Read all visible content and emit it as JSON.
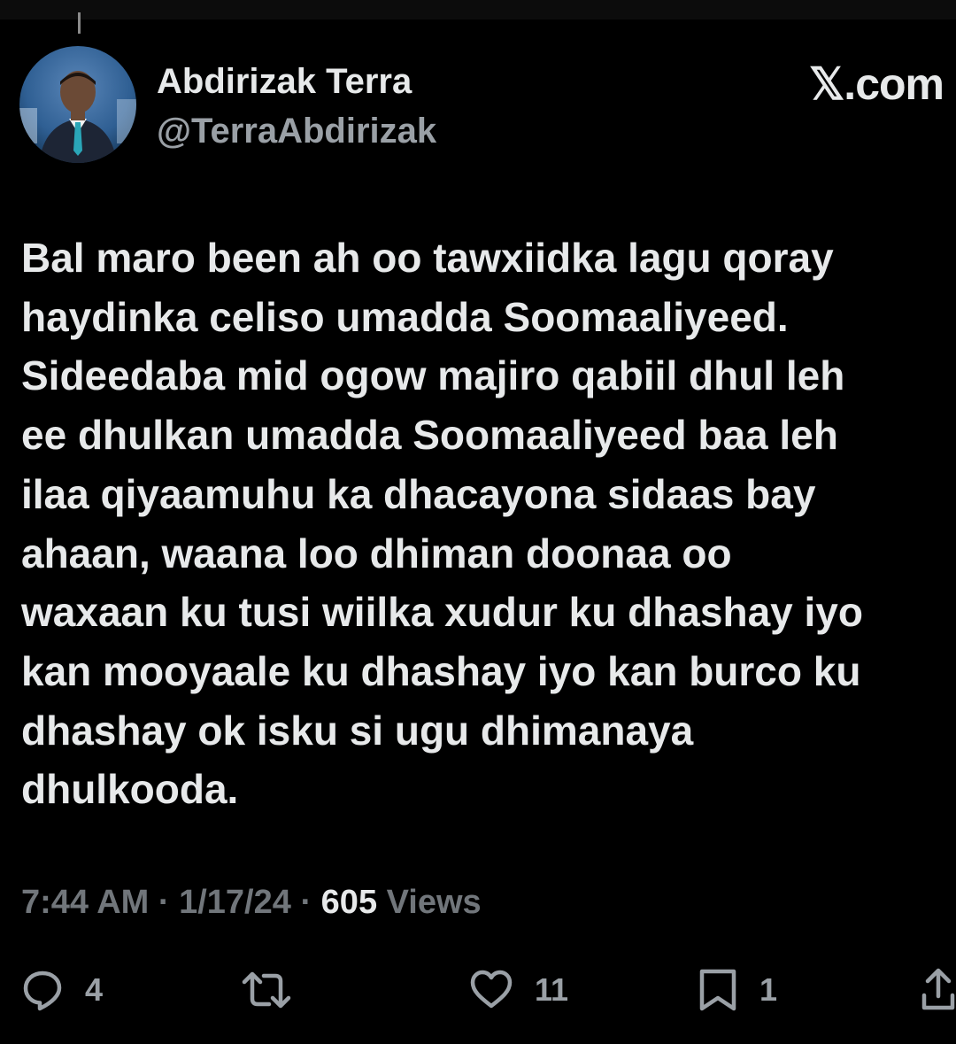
{
  "tweet": {
    "author": {
      "display_name": "Abdirizak Terra",
      "handle": "@TerraAbdirizak",
      "avatar_icon": "profile-photo"
    },
    "brand": "𝕏.com",
    "text": "Bal maro been ah oo tawxiidka lagu qoray\nhaydinka celiso umadda Soomaaliyeed.\nSideedaba mid ogow majiro qabiil dhul leh\nee dhulkan umadda Soomaaliyeed baa leh\nilaa qiyaamuhu ka dhacayona sidaas bay\nahaan, waana loo dhiman doonaa oo\nwaxaan ku tusi wiilka xudur ku dhashay iyo\nkan mooyaale ku dhashay iyo kan burco ku\ndhashay ok isku si ugu dhimanaya\ndhulkooda.",
    "meta": {
      "time": "7:44 AM",
      "separator": " · ",
      "date": "1/17/24",
      "views_count": "605",
      "views_label": "Views"
    },
    "actions": {
      "reply": {
        "icon": "reply-icon",
        "count": "4"
      },
      "repost": {
        "icon": "repost-icon",
        "count": ""
      },
      "like": {
        "icon": "heart-icon",
        "count": "11"
      },
      "bookmark": {
        "icon": "bookmark-icon",
        "count": "1"
      },
      "share": {
        "icon": "share-icon",
        "count": ""
      }
    }
  },
  "colors": {
    "background": "#000000",
    "primary_text": "#e7e9ea",
    "secondary_text": "#71767b",
    "icon_gray": "#9aa0a6"
  }
}
